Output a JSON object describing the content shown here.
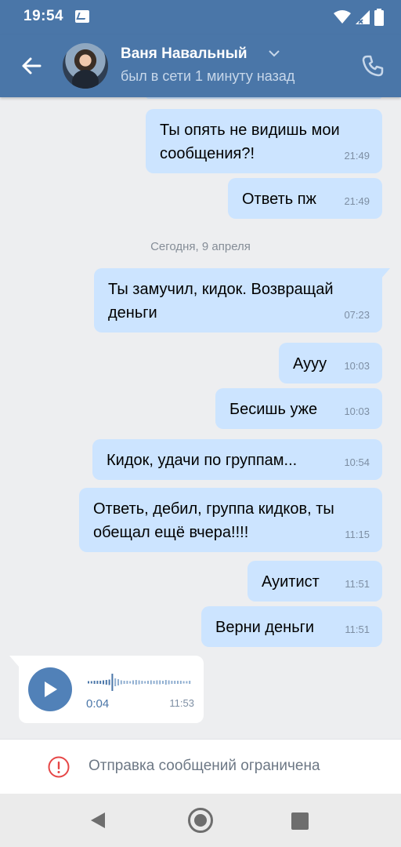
{
  "status_bar": {
    "time": "19:54"
  },
  "header": {
    "contact_name": "Ваня Навальный",
    "contact_status": "был в сети 1 минуту назад",
    "accent_color": "#4a76a8"
  },
  "messages": [
    {
      "text": "Ты опять не видишь мои сообщения?!",
      "time": "21:49"
    },
    {
      "text": "Ответь пж",
      "time": "21:49"
    },
    {
      "text": "Ты замучил, кидок. Возвращай деньги",
      "time": "07:23"
    },
    {
      "text": "Аууу",
      "time": "10:03"
    },
    {
      "text": "Бесишь уже",
      "time": "10:03"
    },
    {
      "text": "Кидок, удачи по группам...",
      "time": "10:54"
    },
    {
      "text": "Ответь, дебил, группа кидков, ты обещал ещё вчера!!!!",
      "time": "11:15"
    },
    {
      "text": "Ауитист",
      "time": "11:51"
    },
    {
      "text": "Верни деньги",
      "time": "11:51"
    }
  ],
  "date_separator": "Сегодня, 9 апреля",
  "voice_message": {
    "duration": "0:04",
    "time": "11:53"
  },
  "restriction_notice": "Отправка сообщений ограничена",
  "colors": {
    "outgoing_bubble": "#cce4ff",
    "incoming_bubble": "#ffffff",
    "warning": "#e64646"
  }
}
